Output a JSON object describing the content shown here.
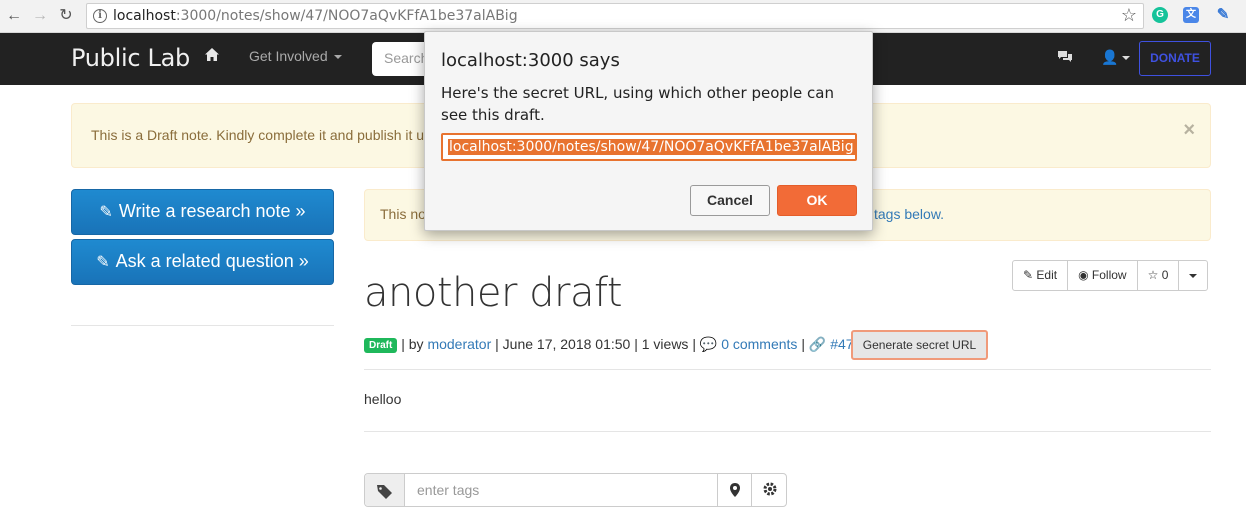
{
  "browser": {
    "url_host": "localhost",
    "url_path": ":3000/notes/show/47/NOO7aQvKFfA1be37alABig"
  },
  "navbar": {
    "brand": "Public Lab",
    "get_involved": "Get Involved",
    "search_placeholder": "Search",
    "donate": "DONATE"
  },
  "draft_alert": {
    "text": "This is a Draft note. Kindly complete it and publish it u",
    "close": "×"
  },
  "sidebar": {
    "write_note": "Write a research note »",
    "ask_question": "Ask a related question »"
  },
  "tag_alert": {
    "text_left": "This no",
    "text_right": "tags below."
  },
  "toolbar": {
    "edit": "Edit",
    "follow": "Follow",
    "stars": "0"
  },
  "note": {
    "title": "another draft",
    "badge": "Draft",
    "by_label": "| by",
    "author": "moderator",
    "date": "| June 17, 2018 01:50 | 1 views |",
    "comments": "0 comments",
    "sep": "|",
    "id": "#47",
    "generate_button": "Generate secret URL",
    "body": "helloo"
  },
  "tags": {
    "placeholder": "enter tags"
  },
  "dialog": {
    "title": "localhost:3000 says",
    "message": "Here's the secret URL, using which other people can see this draft.",
    "input_value": "localhost:3000/notes/show/47/NOO7aQvKFfA1be37alABig",
    "cancel": "Cancel",
    "ok": "OK"
  },
  "colors": {
    "navbar": "#222222",
    "primary": "#1f7fc4",
    "accent": "#f26b37",
    "draft_badge": "#1fb85b",
    "donate": "#3f51e0"
  }
}
